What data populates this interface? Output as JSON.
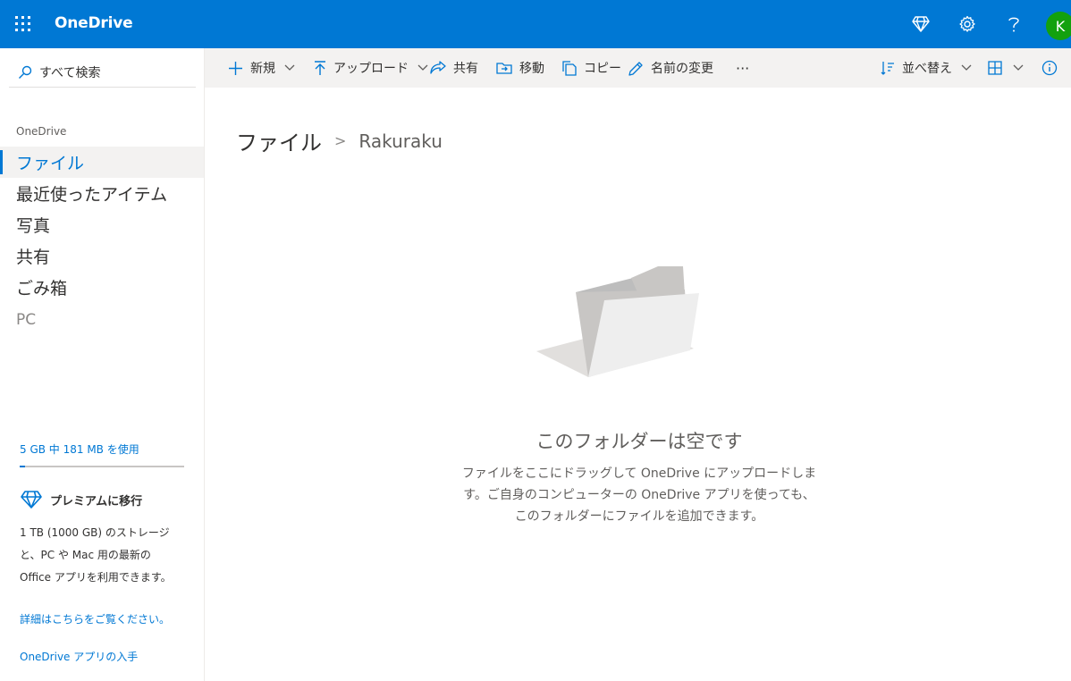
{
  "header": {
    "app_name": "OneDrive",
    "avatar_initial": "K",
    "icons": [
      "waffle-icon",
      "diamond-icon",
      "gear-icon",
      "help-icon"
    ],
    "accent": "#0078d4"
  },
  "sidebar": {
    "search_label": "すべて検索",
    "section_title": "OneDrive",
    "items": [
      {
        "label": "ファイル",
        "active": true
      },
      {
        "label": "最近使ったアイテム"
      },
      {
        "label": "写真"
      },
      {
        "label": "共有"
      },
      {
        "label": "ごみ箱"
      },
      {
        "label": "PC"
      }
    ],
    "storage_text": "5 GB 中 181 MB を使用",
    "storage_fraction": 0.035,
    "premium_label": "プレミアムに移行",
    "premium_desc": "1 TB (1000 GB) のストレージと、PC や Mac 用の最新の Office アプリを利用できます。",
    "details_link": "詳細はこちらをご覧ください。",
    "get_app_link": "OneDrive アプリの入手"
  },
  "commandbar": {
    "new": "新規",
    "upload": "アップロード",
    "share": "共有",
    "move": "移動",
    "copy": "コピー",
    "rename": "名前の変更",
    "more": "···",
    "sort": "並べ替え"
  },
  "breadcrumb": {
    "root": "ファイル",
    "separator": ">",
    "current": "Rakuraku"
  },
  "empty_state": {
    "title": "このフォルダーは空です",
    "line1": "ファイルをここにドラッグして OneDrive にアップロードしま",
    "line2": "す。ご自身のコンピューターの OneDrive アプリを使っても、",
    "line3": "このフォルダーにファイルを追加できます。"
  }
}
